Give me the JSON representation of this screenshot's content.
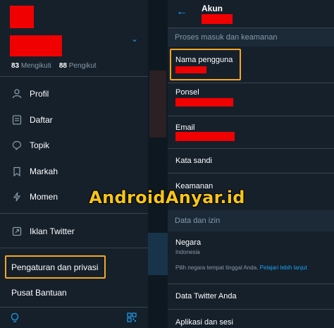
{
  "drawer": {
    "following_count": "83",
    "following_label": "Mengikuti",
    "followers_count": "88",
    "followers_label": "Pengikut",
    "items": [
      {
        "label": "Profil",
        "icon": "person-icon"
      },
      {
        "label": "Daftar",
        "icon": "list-icon"
      },
      {
        "label": "Topik",
        "icon": "topic-icon"
      },
      {
        "label": "Markah",
        "icon": "bookmark-icon"
      },
      {
        "label": "Momen",
        "icon": "lightning-icon"
      }
    ],
    "ads_label": "Iklan Twitter",
    "settings_label": "Pengaturan dan privasi",
    "help_label": "Pusat Bantuan"
  },
  "account": {
    "title": "Akun",
    "section_login": "Proses masuk dan keamanan",
    "username_label": "Nama pengguna",
    "phone_label": "Ponsel",
    "email_label": "Email",
    "password_label": "Kata sandi",
    "security_label": "Keamanan",
    "section_data": "Data dan izin",
    "country_label": "Negara",
    "country_value": "Indonesia",
    "country_note": "Pilih negara tempat tinggal Anda.",
    "country_link": "Pelajari lebih lanjut",
    "twitter_data_label": "Data Twitter Anda",
    "apps_label": "Aplikasi dan sesi"
  },
  "watermark": "AndroidAnyar.id",
  "colors": {
    "accent": "#1da1f2",
    "highlight": "#f5a623",
    "redaction": "#f00000",
    "background": "#15202b"
  }
}
